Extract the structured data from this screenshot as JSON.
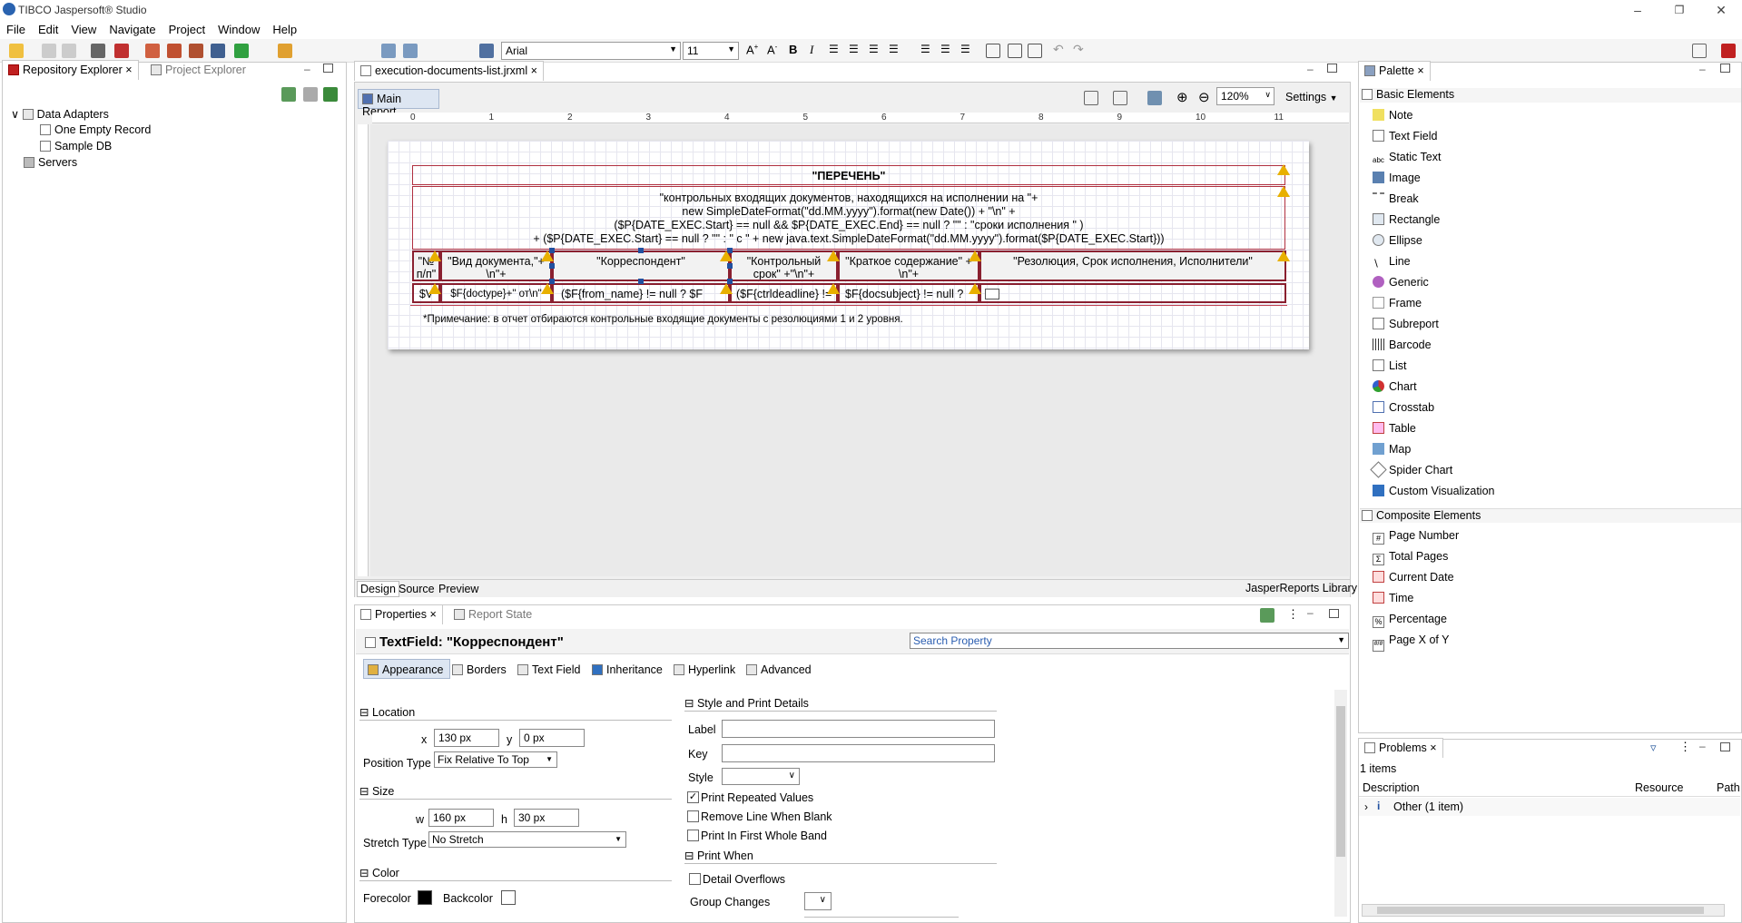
{
  "app": {
    "title": "TIBCO Jaspersoft® Studio"
  },
  "menu": [
    "File",
    "Edit",
    "View",
    "Navigate",
    "Project",
    "Window",
    "Help"
  ],
  "toolbar": {
    "font_name": "Arial",
    "font_size": "11"
  },
  "left_panel": {
    "tabs": [
      "Repository Explorer",
      "Project Explorer"
    ],
    "tree": [
      {
        "label": "Data Adapters"
      },
      {
        "label": "One Empty Record"
      },
      {
        "label": "Sample DB"
      },
      {
        "label": "Servers"
      }
    ]
  },
  "editor": {
    "tab": "execution-documents-list.jrxml",
    "main_report": "Main Report",
    "zoom": "120%",
    "settings": "Settings",
    "ruler": [
      "0",
      "1",
      "2",
      "3",
      "4",
      "5",
      "6",
      "7",
      "8",
      "9",
      "10",
      "11"
    ],
    "bottom_tabs": [
      "Design",
      "Source",
      "Preview"
    ],
    "library": "JasperReports Library"
  },
  "report": {
    "title": "\"ПЕРЕЧЕНЬ\"",
    "subtitle_lines": [
      "\"контрольных входящих документов, находящихся на исполнении на \"+",
      "new SimpleDateFormat(\"dd.MM.yyyy\").format(new Date()) + \"\\n\" +",
      "($P{DATE_EXEC.Start} == null && $P{DATE_EXEC.End} == null ? \"\" : \"сроки исполнения \" )",
      "+ ($P{DATE_EXEC.Start} == null ? \"\" : \" с \" + new java.text.SimpleDateFormat(\"dd.MM.yyyy\").format($P{DATE_EXEC.Start}))"
    ],
    "headers": [
      [
        "\"№",
        "п/п\""
      ],
      [
        "\"Вид документа,\"+",
        "\\n\"+"
      ],
      [
        "\"Корреспондент\"",
        ""
      ],
      [
        "\"Контрольный",
        "срок\" +\"\\n\"+"
      ],
      [
        "\"Краткое содержание\" +",
        "\\n\"+"
      ],
      [
        "\"Резолюция, Срок исполнения, Исполнители\"",
        ""
      ]
    ],
    "details": [
      "$V",
      "$F{doctype}+\" от\\n\"",
      "($F{from_name} != null ? $F",
      "($F{ctrldeadline} !=",
      "$F{docsubject} != null ?",
      ""
    ],
    "note": "*Примечание: в отчет отбираются контрольные входящие документы с резолюциями 1 и 2 уровня."
  },
  "palette": {
    "tab": "Palette",
    "basic_header": "Basic Elements",
    "basic": [
      "Note",
      "Text Field",
      "Static Text",
      "Image",
      "Break",
      "Rectangle",
      "Ellipse",
      "Line",
      "Generic",
      "Frame",
      "Subreport",
      "Barcode",
      "List",
      "Chart",
      "Crosstab",
      "Table",
      "Map",
      "Spider Chart",
      "Custom Visualization"
    ],
    "composite_header": "Composite Elements",
    "composite": [
      "Page Number",
      "Total Pages",
      "Current Date",
      "Time",
      "Percentage",
      "Page X of Y"
    ]
  },
  "properties": {
    "tabs": [
      "Properties",
      "Report State"
    ],
    "element_title": "TextField: \"Корреспондент\"",
    "search_placeholder": "Search Property",
    "sub_tabs": [
      "Appearance",
      "Borders",
      "Text Field",
      "Inheritance",
      "Hyperlink",
      "Advanced"
    ],
    "location_header": "Location",
    "x_label": "x",
    "x_value": "130 px",
    "y_label": "y",
    "y_value": "0 px",
    "position_type_label": "Position Type",
    "position_type_value": "Fix Relative To Top",
    "size_header": "Size",
    "w_label": "w",
    "w_value": "160 px",
    "h_label": "h",
    "h_value": "30 px",
    "stretch_label": "Stretch Type",
    "stretch_value": "No Stretch",
    "color_header": "Color",
    "forecolor_label": "Forecolor",
    "forecolor": "#000000",
    "backcolor_label": "Backcolor",
    "backcolor": "#ffffff",
    "style_header": "Style and Print Details",
    "label_label": "Label",
    "key_label": "Key",
    "style_label": "Style",
    "print_repeated": "Print Repeated Values",
    "print_repeated_checked": true,
    "remove_line": "Remove Line When Blank",
    "print_first": "Print In First Whole Band",
    "print_when_header": "Print When",
    "detail_overflows": "Detail Overflows",
    "group_changes": "Group Changes"
  },
  "problems": {
    "tab": "Problems",
    "count": "1 items",
    "columns": [
      "Description",
      "Resource",
      "Path"
    ],
    "row": "Other (1 item)"
  }
}
